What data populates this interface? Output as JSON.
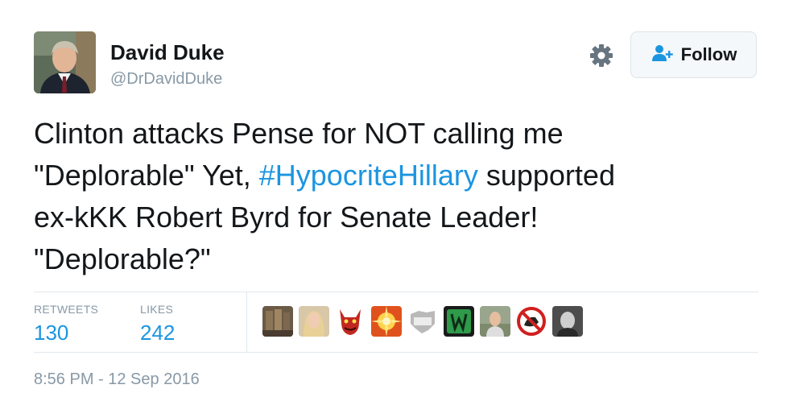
{
  "author": {
    "name": "David Duke",
    "handle": "@DrDavidDuke"
  },
  "actions": {
    "follow_label": "Follow"
  },
  "tweet": {
    "line1": "Clinton attacks Pense for NOT calling me",
    "line2_before": "\"Deplorable\" Yet, ",
    "hashtag": "#HypocriteHillary",
    "line2_after": " supported",
    "line3": "ex-kKK Robert Byrd for Senate Leader!",
    "line4": "\"Deplorable?\""
  },
  "stats": {
    "retweets_label": "RETWEETS",
    "retweets_count": "130",
    "likes_label": "LIKES",
    "likes_count": "242"
  },
  "timestamp": "8:56 PM - 12 Sep 2016",
  "colors": {
    "link": "#1b95e0",
    "muted": "#8899a6",
    "text": "#14171a"
  }
}
